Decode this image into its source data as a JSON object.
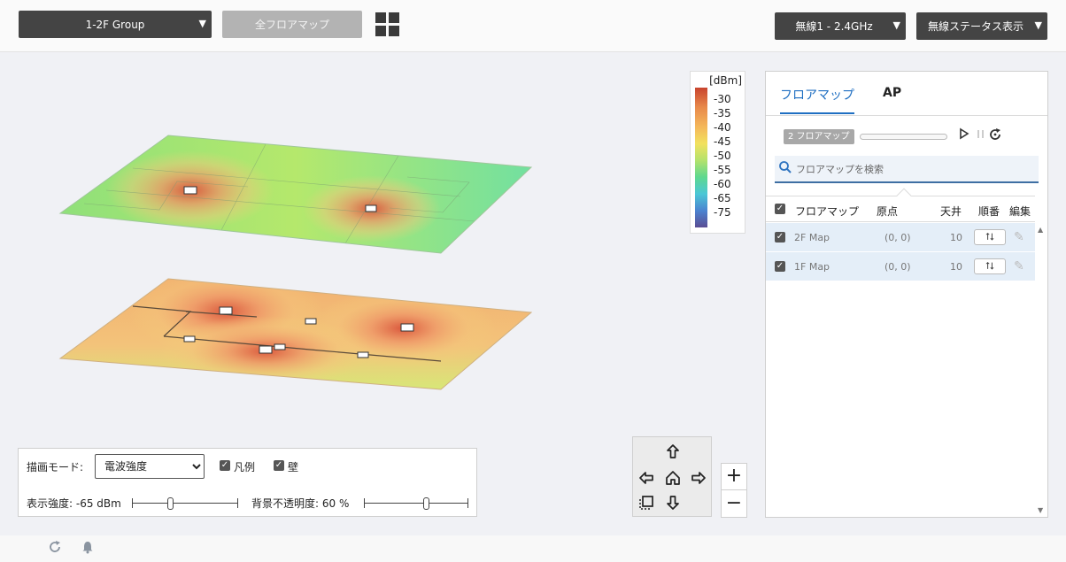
{
  "toolbar": {
    "group_select": "1-2F Group",
    "all_floors_button": "全フロアマップ",
    "band_select": "無線1 - 2.4GHz",
    "status_select": "無線ステータス表示"
  },
  "legend": {
    "unit": "[dBm]",
    "ticks": [
      "-30",
      "-35",
      "-40",
      "-45",
      "-50",
      "-55",
      "-60",
      "-65",
      "-75"
    ]
  },
  "panel": {
    "tabs": [
      "フロアマップ",
      "AP"
    ],
    "active_tab": "フロアマップ",
    "badge": "2 フロアマップ",
    "search_placeholder": "フロアマップを検索",
    "columns": [
      "フロアマップ",
      "原点",
      "天井",
      "順番",
      "編集"
    ],
    "rows": [
      {
        "name": "2F Map",
        "origin": "(0, 0)",
        "ceiling": "10",
        "checked": true
      },
      {
        "name": "1F Map",
        "origin": "(0, 0)",
        "ceiling": "10",
        "checked": true
      }
    ]
  },
  "controls": {
    "draw_mode_label": "描画モード:",
    "draw_mode_value": "電波強度",
    "legend_checkbox": "凡例",
    "wall_checkbox": "壁",
    "strength_label": "表示強度: -65 dBm",
    "strength_value_dbm": -65,
    "opacity_label": "背景不透明度: 60 %",
    "opacity_percent": 60
  },
  "icons": {
    "grid_view": "grid-view-icon",
    "nav": [
      "arrow-up-icon",
      "arrow-left-icon",
      "home-icon",
      "arrow-right-icon",
      "select-area-icon",
      "arrow-down-icon"
    ],
    "zoom": [
      "zoom-in-icon",
      "zoom-out-icon"
    ],
    "status": [
      "refresh-icon",
      "bell-icon"
    ]
  },
  "colors": {
    "accent": "#1f6fc2",
    "dropdown_bg": "#444444",
    "disabled_bg": "#b3b3b3"
  }
}
